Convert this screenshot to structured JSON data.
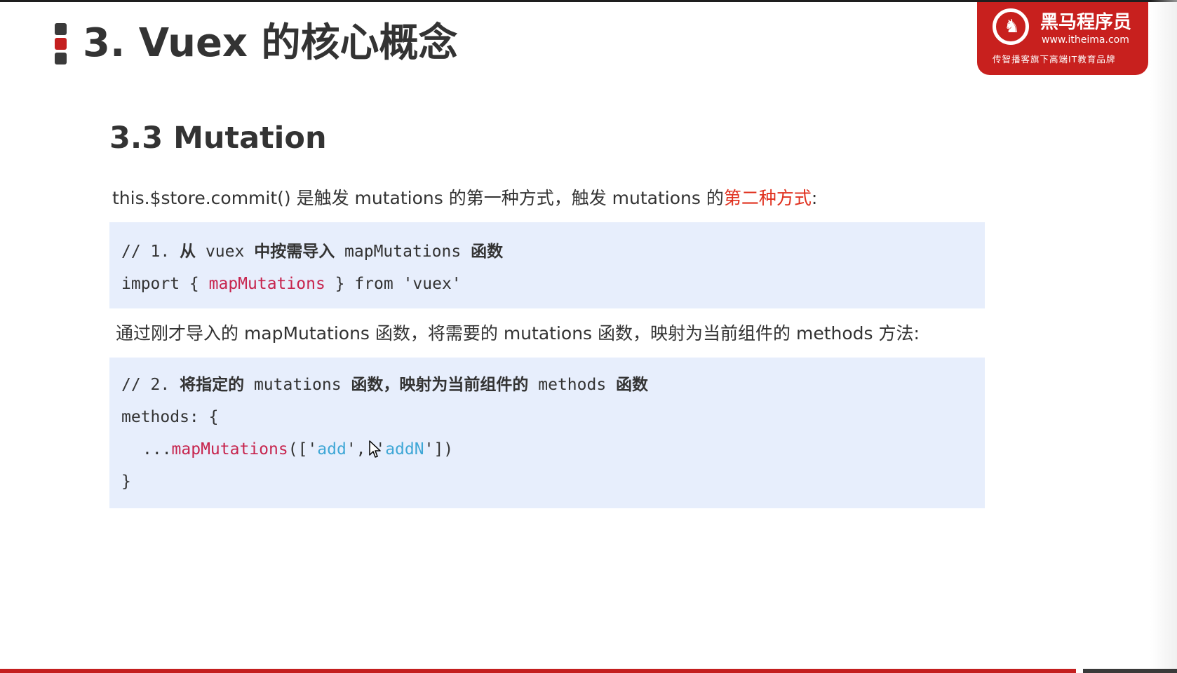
{
  "title": "3. Vuex 的核心概念",
  "logo": {
    "name": "黑马程序员",
    "url": "www.itheima.com",
    "slogan": "传智播客旗下高端IT教育品牌"
  },
  "section": {
    "title": "3.3 Mutation",
    "para1_prefix": "this.$store.commit() 是触发 mutations 的第一种方式，触发 mutations 的",
    "para1_highlight": "第二种方式",
    "para1_suffix": ":",
    "para2": "通过刚才导入的 mapMutations 函数，将需要的 mutations 函数，映射为当前组件的 methods 方法:"
  },
  "code1": {
    "comment_prefix": "// 1. ",
    "comment_cn1": "从",
    "comment_mid": " vuex ",
    "comment_cn2": "中按需导入",
    "comment_mid2": " mapMutations ",
    "comment_cn3": "函数",
    "import_kw": "import { ",
    "import_fn": "mapMutations",
    "import_rest": " } from 'vuex'"
  },
  "code2": {
    "comment_prefix": "// 2. ",
    "comment_cn1": "将指定的",
    "comment_mid": " mutations ",
    "comment_cn2": "函数，映射为当前组件的",
    "comment_mid2": " methods ",
    "comment_cn3": "函数",
    "methods_line": "methods: {",
    "spread": "...",
    "fn": "mapMutations",
    "open": "(['",
    "str1": "add",
    "sep": "', '",
    "str2": "addN",
    "close": "'])",
    "end": "}"
  },
  "colors": {
    "accent_red": "#c41f1f",
    "highlight_red": "#e0301e",
    "code_bg": "#e7eefc",
    "code_fn": "#c7254e",
    "code_str": "#3fa7d6"
  }
}
